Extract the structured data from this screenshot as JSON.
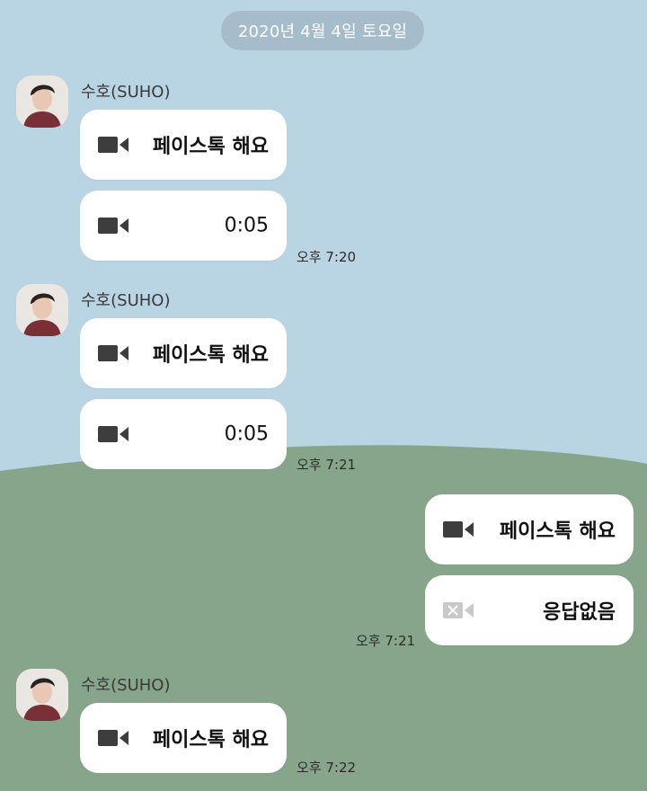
{
  "date_divider": "2020년 4월 4일 토요일",
  "messages": [
    {
      "sender": "수호(SUHO)",
      "call1_label": "페이스톡 해요",
      "call2_label": "0:05",
      "time": "오후 7:20"
    },
    {
      "sender": "수호(SUHO)",
      "call1_label": "페이스톡 해요",
      "call2_label": "0:05",
      "time": "오후 7:21"
    },
    {
      "mine": true,
      "call1_label": "페이스톡 해요",
      "call2_label": "응답없음",
      "time": "오후 7:21"
    },
    {
      "sender": "수호(SUHO)",
      "call1_label": "페이스톡 해요",
      "time": "오후 7:22"
    }
  ],
  "icons": {
    "call": "video-camera-icon",
    "missed": "video-camera-missed-icon",
    "avatar": "profile-avatar"
  },
  "colors": {
    "sky": "#b9d4e3",
    "hill": "#86a58a",
    "bubble": "#ffffff",
    "icon": "#3d3d3d",
    "missed_icon": "#c9c9c9"
  }
}
